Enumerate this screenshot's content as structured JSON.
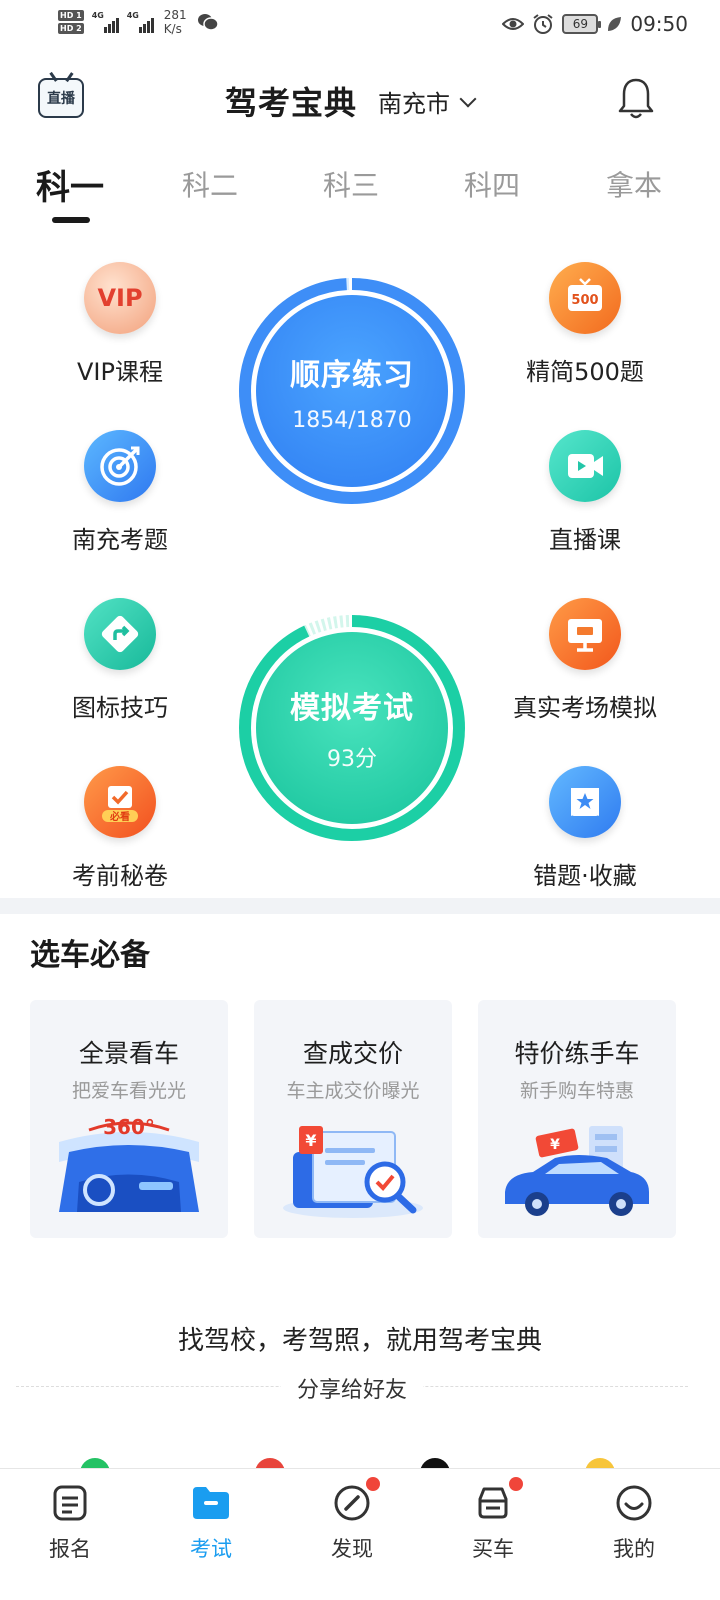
{
  "status_bar": {
    "hd1": "HD 1",
    "hd2": "HD 2",
    "net1": "4G",
    "net2": "4G",
    "speed_value": "281",
    "speed_unit": "K/s",
    "battery": "69",
    "time": "09:50"
  },
  "header": {
    "live_label": "直播",
    "title": "驾考宝典",
    "city": "南充市"
  },
  "tabs": [
    {
      "label": "科一",
      "active": true
    },
    {
      "label": "科二",
      "active": false
    },
    {
      "label": "科三",
      "active": false
    },
    {
      "label": "科四",
      "active": false
    },
    {
      "label": "拿本",
      "active": false
    }
  ],
  "features": {
    "vip": {
      "label": "VIP课程",
      "icon_text": "VIP"
    },
    "local": {
      "label": "南充考题"
    },
    "signs": {
      "label": "图标技巧"
    },
    "secret": {
      "label": "考前秘卷",
      "icon_text": "必看"
    },
    "q500": {
      "label": "精简500题",
      "icon_text": "500"
    },
    "live": {
      "label": "直播课"
    },
    "real": {
      "label": "真实考场模拟"
    },
    "wrong": {
      "label": "错题·收藏"
    }
  },
  "practice": {
    "title": "顺序练习",
    "progress_text": "1854/1870",
    "done": 1854,
    "total": 1870
  },
  "mock": {
    "title": "模拟考试",
    "score_text": "93分",
    "score": 93
  },
  "car_section": {
    "title": "选车必备",
    "cards": [
      {
        "title": "全景看车",
        "subtitle": "把爱车看光光",
        "badge": "360°"
      },
      {
        "title": "查成交价",
        "subtitle": "车主成交价曝光",
        "badge": "¥"
      },
      {
        "title": "特价练手车",
        "subtitle": "新手购车特惠",
        "badge": "¥"
      }
    ]
  },
  "footer": {
    "slogan": "找驾校，考驾照，就用驾考宝典",
    "share": "分享给好友"
  },
  "bottom_nav": [
    {
      "label": "报名",
      "active": false,
      "dot": false
    },
    {
      "label": "考试",
      "active": true,
      "dot": false
    },
    {
      "label": "发现",
      "active": false,
      "dot": true
    },
    {
      "label": "买车",
      "active": false,
      "dot": true
    },
    {
      "label": "我的",
      "active": false,
      "dot": false
    }
  ],
  "colors": {
    "accent_blue": "#1a9df0",
    "practice_blue": "#3f8ff7",
    "mock_green": "#1ccfa5",
    "badge_red": "#f0453a"
  }
}
